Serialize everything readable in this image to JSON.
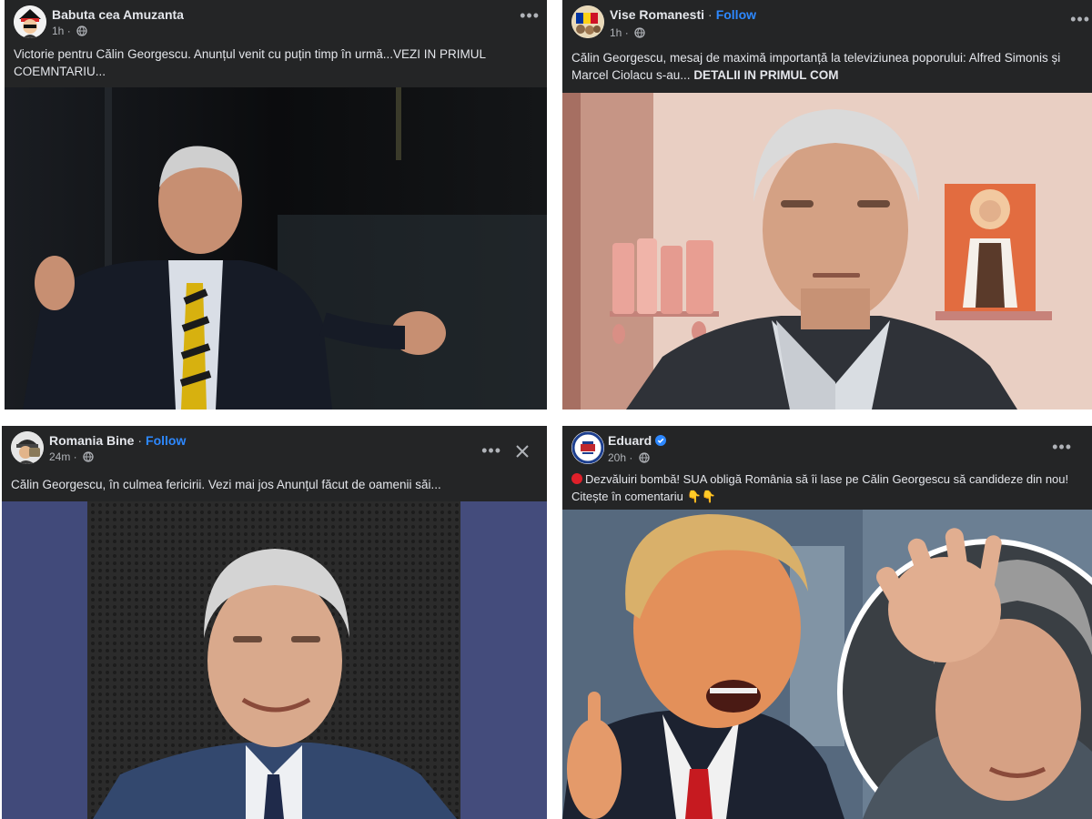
{
  "posts": [
    {
      "author": "Babuta cea Amuzanta",
      "time": "1h",
      "text": "Victorie pentru Călin Georgescu. Anunțul venit cu puțin timp în urmă...VEZI IN PRIMUL COEMNTARIU..."
    },
    {
      "author": "Vise Romanesti",
      "separator": "·",
      "follow": "Follow",
      "time": "1h",
      "text": "Călin Georgescu, mesaj de maximă importanță la televiziunea poporului: Alfred Simonis și Marcel Ciolacu s-au...",
      "text_bold": "DETALII IN PRIMUL COM"
    },
    {
      "author": "Romania Bine",
      "separator": "·",
      "follow": "Follow",
      "time": "24m",
      "text": "Călin Georgescu, în culmea fericirii. Vezi mai jos Anunțul făcut de oamenii săi..."
    },
    {
      "author": "Eduard",
      "time": "20h",
      "text": "Dezvăluiri bombă! SUA obligă România să îi lase pe Călin Georgescu să candideze din nou!",
      "text_line2": "Citește în comentariu 👇👇"
    }
  ],
  "icons": {
    "more": "more-options-icon",
    "close": "close-icon",
    "globe": "globe-icon",
    "verified": "verified-badge-icon"
  },
  "colors": {
    "post_bg": "#242526",
    "follow": "#2d88ff",
    "text": "#e4e6eb",
    "secondary": "#b0b3b8"
  }
}
